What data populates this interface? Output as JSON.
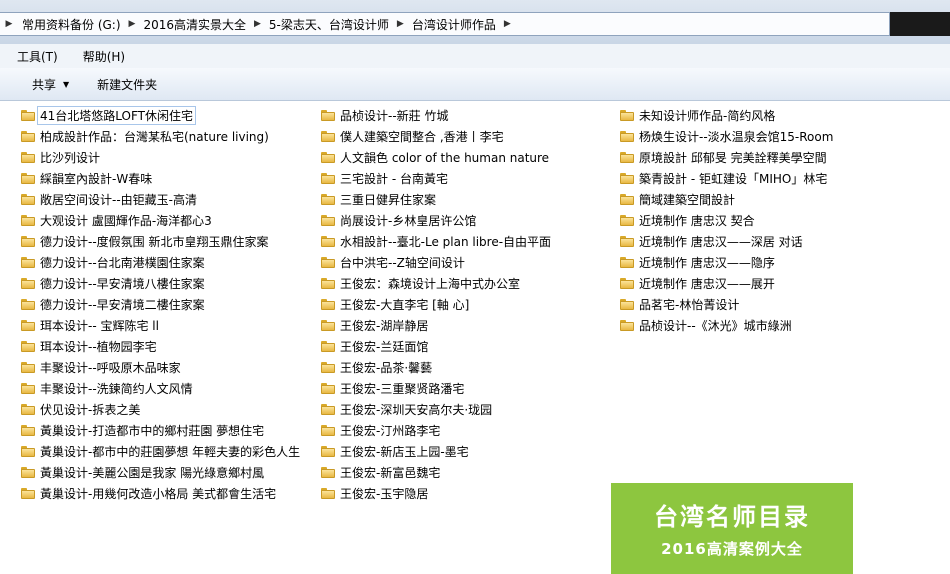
{
  "breadcrumb": [
    "常用资料备份 (G:)",
    "2016高清实景大全",
    "5-梁志天、台湾设计师",
    "台湾设计师作品"
  ],
  "menu": {
    "tools": "工具(T)",
    "help": "帮助(H)"
  },
  "toolbar": {
    "share": "共享",
    "new_folder": "新建文件夹"
  },
  "columns": [
    [
      "41台北塔悠路LOFT休闲住宅",
      "柏成設計作品：台灣某私宅(nature living)",
      "比沙列设计",
      "綵韻室內設計-W春味",
      "敞居空间设计--由钜藏玉-高清",
      "大观设计 盧國輝作品-海洋都心3",
      "德力设计--度假氛围 新北市皇翔玉鼎住家案",
      "德力设计--台北南港樸園住家案",
      "德力设计--早安清境八樓住家案",
      "德力设计--早安清境二樓住家案",
      "珥本设计-- 宝辉陈宅 ll",
      "珥本设计--植物园李宅",
      "丰聚设计--呼吸原木品味家",
      "丰聚设计--洗鍊简约人文风情",
      "伏见设计-拆表之美",
      "黃巢设计-打造都市中的鄉村莊園 夢想住宅",
      "黃巢设计-都市中的莊園夢想 年輕夫妻的彩色人生",
      "黃巢设计-美麗公園是我家 陽光綠意鄉村風",
      "黃巢设计-用幾何改造小格局 美式都會生活宅"
    ],
    [
      "品桢设计--新莊 竹城",
      "僕人建築空間整合 ,香港丨李宅",
      "人文韻色 color of the human nature",
      "三宅設計 - 台南黃宅",
      "三重日健昇住家案",
      "尚展设计-乡林皇居许公馆",
      "水相設計--臺北-Le plan libre-自由平面",
      "台中洪宅--Z轴空间设计",
      "王俊宏：森境设计上海中式办公室",
      "王俊宏-大直李宅 [軸 心]",
      "王俊宏-湖岸静居",
      "王俊宏-兰廷面馆",
      "王俊宏-品茶·馨藝",
      "王俊宏-三重聚贤路潘宅",
      "王俊宏-深圳天安高尔夫·珑园",
      "王俊宏-汀州路李宅",
      "王俊宏-新店玉上园-墨宅",
      "王俊宏-新富邑魏宅",
      "王俊宏-玉宇隐居"
    ],
    [
      "未知设计师作品-简约风格",
      "杨焕生设计--淡水温泉会馆15-Room",
      "原境設計 邱郁旻 完美詮釋美學空間",
      "築青設計 - 钜虹建设「MIHO」林宅",
      "簡域建築空間設計",
      "近境制作 唐忠汉 契合",
      "近境制作 唐忠汉——深居 对话",
      "近境制作 唐忠汉——隐序",
      "近境制作 唐忠汉——展开",
      "品茗宅-林怡菁设计",
      "品桢设计--《沐光》城市綠洲"
    ]
  ],
  "banner": {
    "title": "台湾名师目录",
    "subtitle": "2016高清案例大全",
    "color": "#8dc63f"
  },
  "selected_item": "41台北塔悠路LOFT休闲住宅"
}
